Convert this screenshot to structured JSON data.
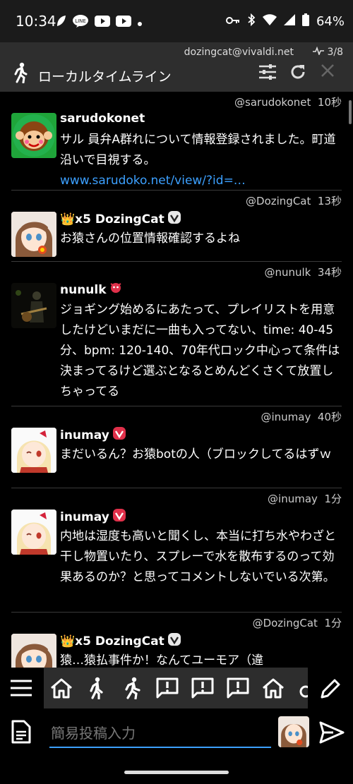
{
  "status_bar": {
    "time": "10:34",
    "battery": "64%",
    "line_icon_text": "LINE"
  },
  "header": {
    "account": "dozingcat@vivaldi.net",
    "counter": "3/8",
    "title": "ローカルタイムライン"
  },
  "posts": [
    {
      "handle": "@sarudokonet",
      "time": "10秒",
      "name": "sarudokonet",
      "text": "サル 員弁A群れについて情報登録されました。町道沿いで目視する。",
      "link": "www.sarudoko.net/view/?id=…"
    },
    {
      "handle": "@DozingCat",
      "time": "13秒",
      "name": "👑x5 DozingCat",
      "text": "お猿さんの位置情報確認するよね"
    },
    {
      "handle": "@nunulk",
      "time": "34秒",
      "name": "nunulk",
      "text": "ジョギング始めるにあたって、プレイリストを用意したけどいまだに一曲も入ってない、time: 40-45分、bpm: 120-140、70年代ロック中心って条件は決まってるけど選ぶとなるとめんどくさくて放置しちゃってる"
    },
    {
      "handle": "@inumay",
      "time": "40秒",
      "name": "inumay",
      "text": "まだいるん？お猿botの人（ブロックしてるはずｗ"
    },
    {
      "handle": "@inumay",
      "time": "1分",
      "name": "inumay",
      "text": "内地は湿度も高いと聞くし、本当に打ち水やわざと干し物置いたり、スプレーで水を散布するのって効果あるのか？と思ってコメントしないでいる次第。"
    },
    {
      "handle": "@DozingCat",
      "time": "1分",
      "name": "👑x5 DozingCat",
      "text": "猿…猿払事件か！なんてユーモア（違"
    }
  ],
  "compose": {
    "placeholder": "簡易投稿入力"
  },
  "icons": {
    "header": [
      "runner-icon",
      "filter-settings-icon",
      "refresh-icon",
      "close-icon"
    ],
    "tabs": [
      "home-icon",
      "walk-icon",
      "run-icon",
      "alert-icon",
      "alert-icon",
      "alert-icon",
      "home-icon",
      "gender-icon"
    ],
    "bottom": [
      "menu-icon",
      "edit-icon",
      "document-icon",
      "send-icon"
    ]
  },
  "colors": {
    "link": "#3ca0ff",
    "header_bg": "#2e2e2e",
    "tab_bg": "#2d2d2d",
    "badge_red": "#e0304a"
  }
}
